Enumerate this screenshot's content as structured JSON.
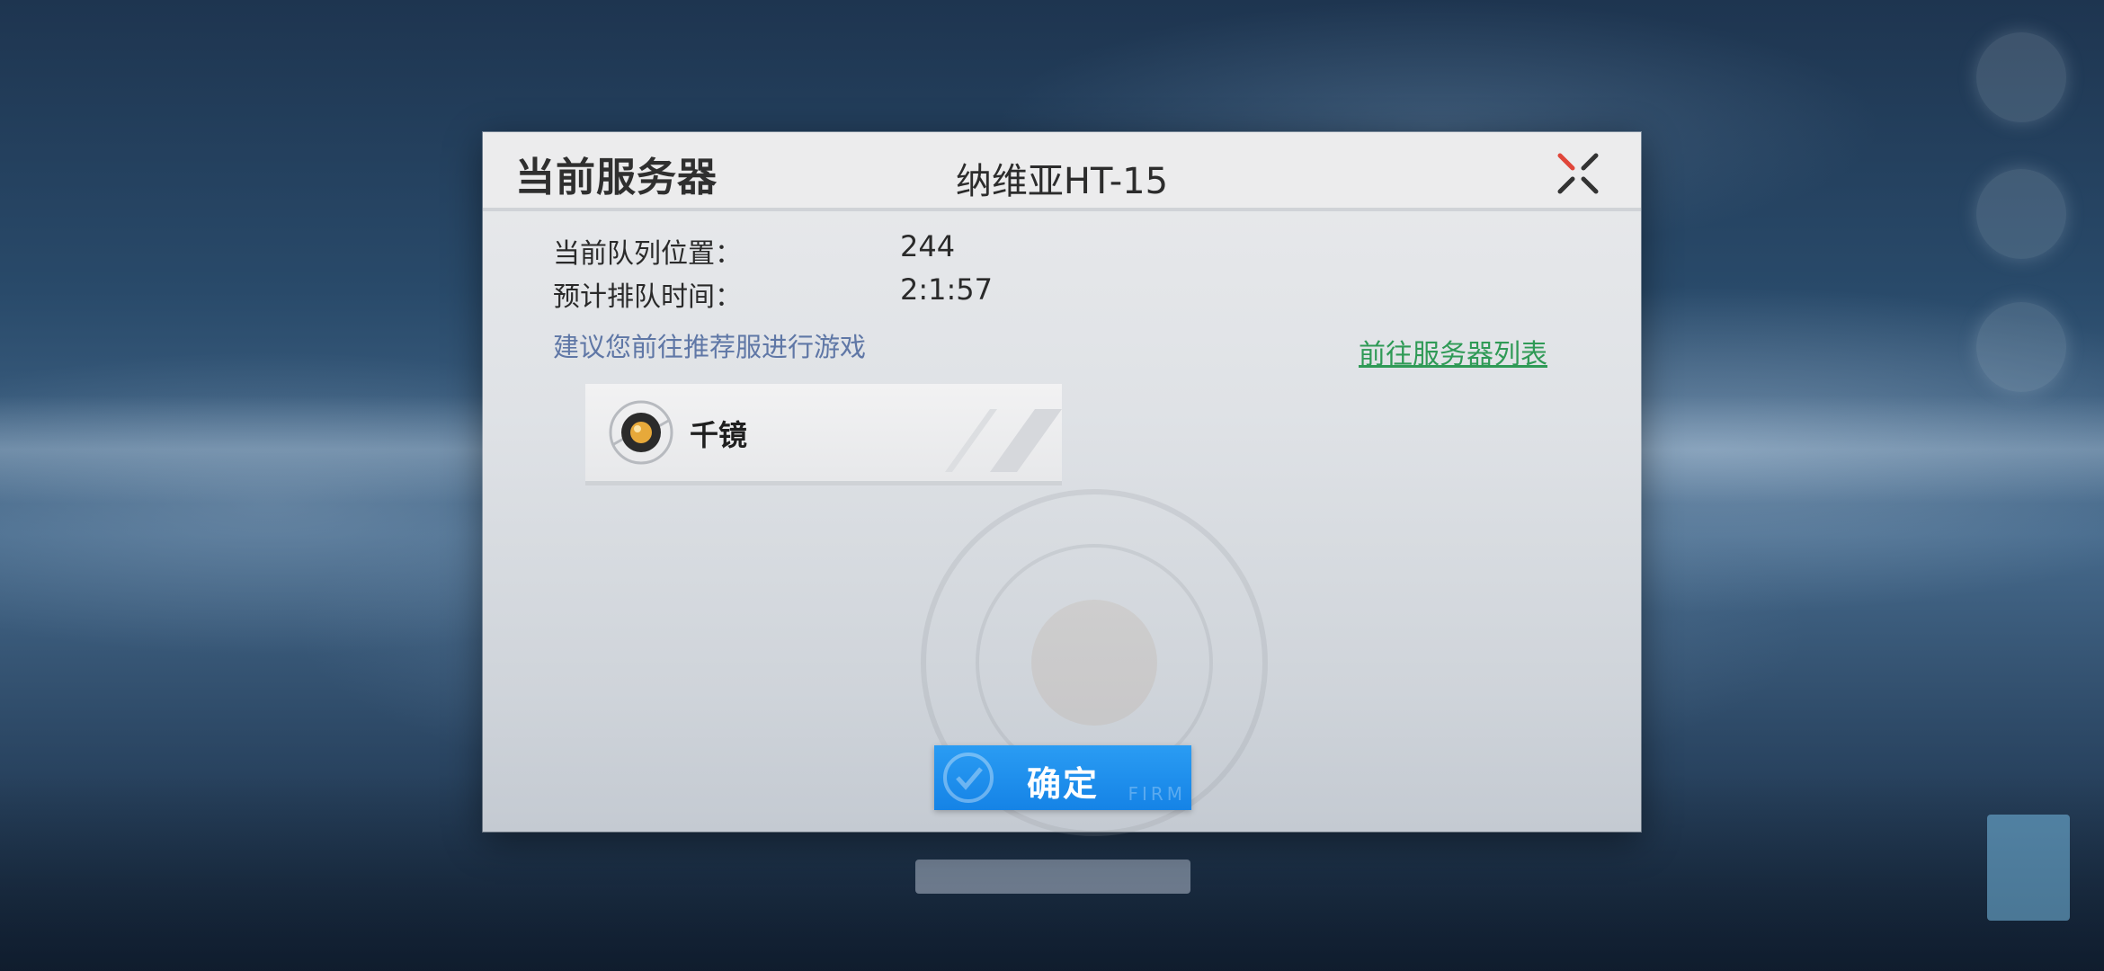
{
  "dialog": {
    "title": "当前服务器",
    "server_name": "纳维亚HT-15",
    "queue_position_label": "当前队列位置：",
    "queue_position_value": "244",
    "estimated_time_label": "预计排队时间：",
    "estimated_time_value": "2:1:57",
    "suggestion_text": "建议您前往推荐服进行游戏",
    "server_list_link": "前往服务器列表",
    "recommended_server": {
      "name": "千镜",
      "status_icon": "server-status-icon"
    },
    "confirm_button": {
      "label": "确定",
      "sub_label": "FIRM"
    },
    "close_icon": "close-icon"
  },
  "colors": {
    "confirm_blue": "#1e8ff0",
    "link_green": "#2f9a56",
    "suggestion_blue": "#5f77a6",
    "close_accent_red": "#e0463a"
  }
}
